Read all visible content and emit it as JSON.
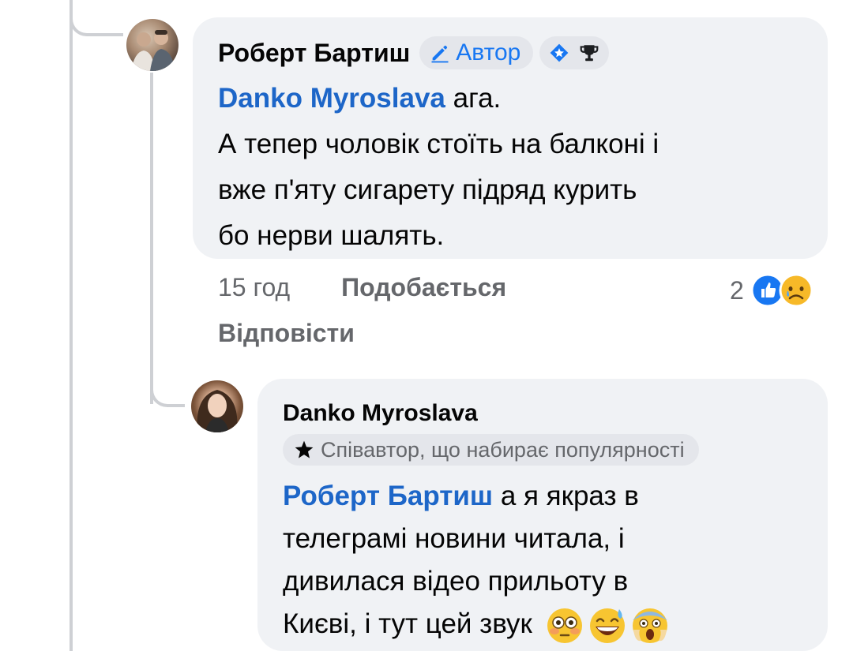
{
  "comment_1": {
    "author": "Роберт Бартиш",
    "author_badge": "Автор",
    "badge_icons": [
      "diamond-star-icon",
      "trophy-icon"
    ],
    "mention": "Danko Myroslava",
    "text_after_mention": " ага.",
    "text_lines": [
      "А тепер чоловік стоїть на балконі і",
      "вже п'яту сигарету підряд курить",
      "бо нерви шалять."
    ],
    "time": "15 год",
    "like_label": "Подобається",
    "reply_label": "Відповісти",
    "reaction_count": "2",
    "reactions": [
      "like-reaction-icon",
      "sad-reaction-icon"
    ]
  },
  "comment_2": {
    "author": "Danko Myroslava",
    "badge": "Співавтор, що набирає популярності",
    "mention": "Роберт Бартиш",
    "text_after_mention": " а я якраз  в",
    "text_lines": [
      "телеграмі новини читала, і",
      "дивилася відео прильоту в",
      "Києві, і тут цей звук"
    ],
    "emojis": [
      "flushed-face-emoji",
      "grinning-sweat-emoji",
      "screaming-face-emoji"
    ]
  },
  "colors": {
    "bubble": "#f0f2f5",
    "mention": "#1d66c8",
    "accent": "#1877f2",
    "muted_text": "#65676b",
    "thread_line": "#ced0d4"
  }
}
